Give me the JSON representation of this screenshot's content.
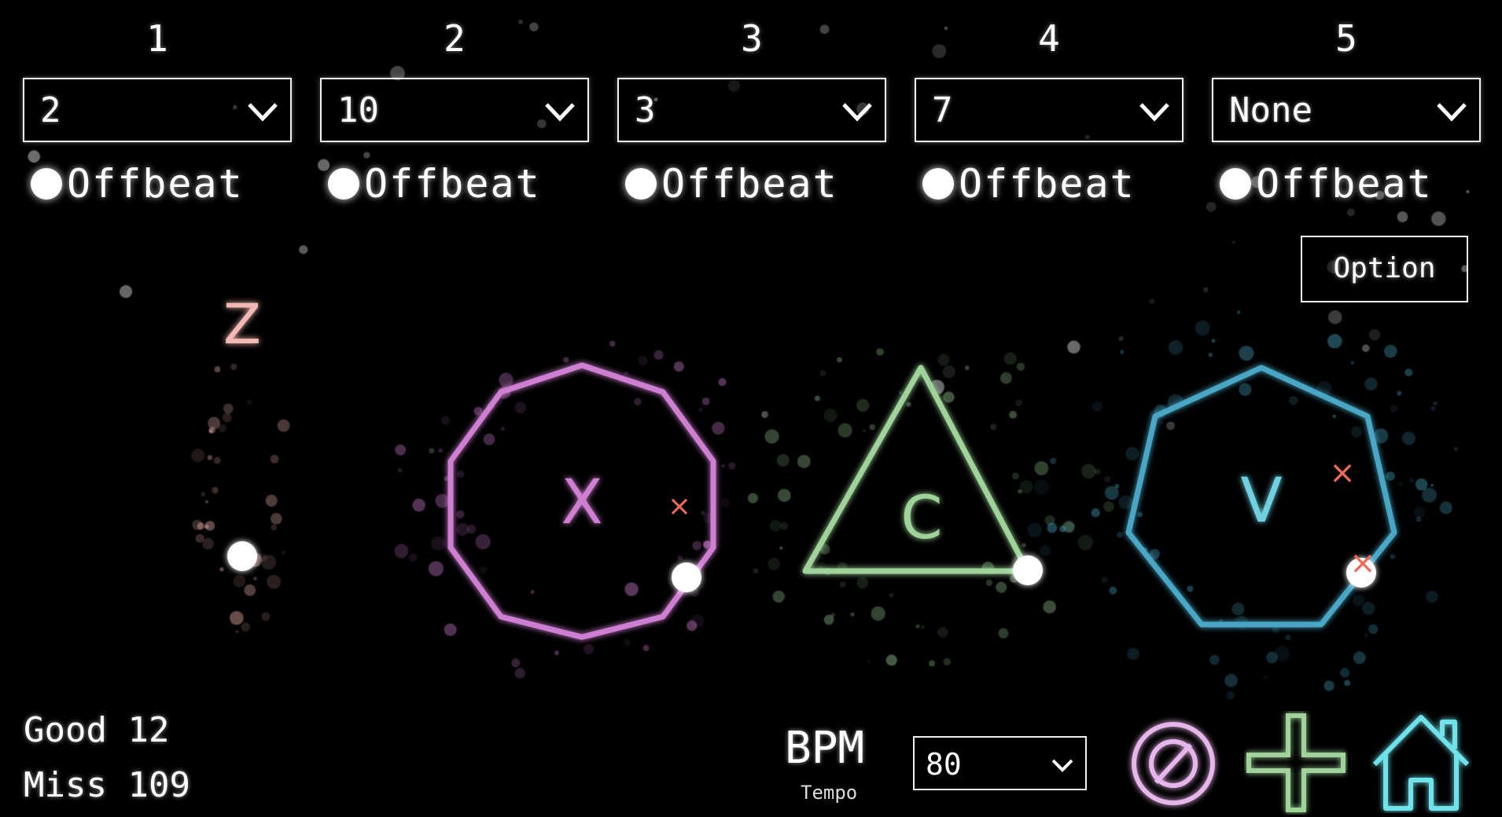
{
  "columns": [
    {
      "number": "1",
      "value": "2",
      "offbeat_label": "Offbeat"
    },
    {
      "number": "2",
      "value": "10",
      "offbeat_label": "Offbeat"
    },
    {
      "number": "3",
      "value": "3",
      "offbeat_label": "Offbeat"
    },
    {
      "number": "4",
      "value": "7",
      "offbeat_label": "Offbeat"
    },
    {
      "number": "5",
      "value": "None",
      "offbeat_label": "Offbeat"
    }
  ],
  "option_label": "Option",
  "pads": {
    "z": {
      "label": "Z",
      "color": "#f2b8b4"
    },
    "x": {
      "label": "X",
      "color": "#cf7fd1"
    },
    "c": {
      "label": "C",
      "color": "#9fd39a"
    },
    "v": {
      "label": "V",
      "color": "#4aa6c4"
    }
  },
  "miss_mark_color": "#f06a5a",
  "score": {
    "good_label": "Good",
    "good_value": "12",
    "miss_label": "Miss",
    "miss_value": "109"
  },
  "bpm": {
    "label": "BPM",
    "sub_label": "Tempo",
    "value": "80"
  },
  "icons": {
    "clear": "clear-circle-icon",
    "add": "plus-icon",
    "home": "home-icon"
  }
}
